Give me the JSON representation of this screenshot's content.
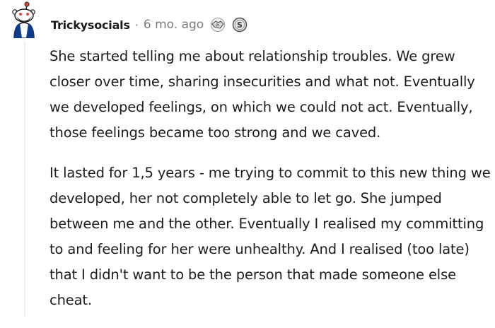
{
  "comment": {
    "author": "Trickysocials",
    "separator": "·",
    "timestamp": "6 mo. ago",
    "awards": [
      "handshake-award-icon",
      "silver-award-icon"
    ],
    "paragraphs": [
      "She started telling me about relationship troubles. We grew closer over time, sharing insecurities and what not. Eventually we developed feelings, on which we could not act. Eventually, those feelings became too strong and we caved.",
      "It lasted for 1,5 years - me trying to commit to this new thing we developed, her not completely able to let go. She jumped between me and the other. Eventually I realised my committing to and feeling for her were unhealthy. And I realised (too late) that I didn't want to be the person that made someone else cheat."
    ]
  },
  "colors": {
    "text": "#1c1c1c",
    "meta": "#7c7c7c",
    "thread_line": "#edeff1",
    "avatar_jacket": "#0d3c8c",
    "avatar_body": "#ffffff"
  }
}
